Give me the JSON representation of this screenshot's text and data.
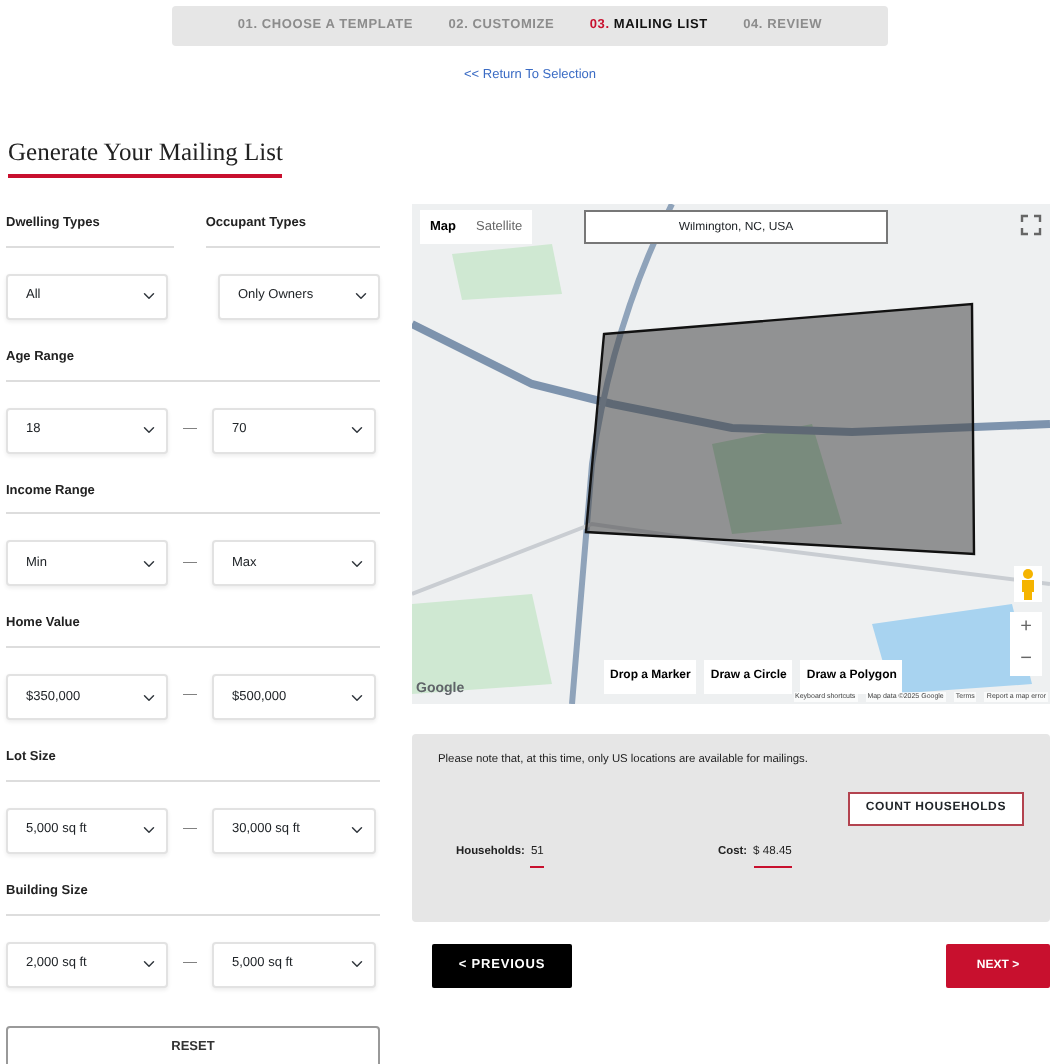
{
  "steps": [
    {
      "number": "01.",
      "label": "CHOOSE A TEMPLATE",
      "selected": false
    },
    {
      "number": "02.",
      "label": "CUSTOMIZE",
      "selected": false
    },
    {
      "number": "03.",
      "label": "MAILING LIST",
      "selected": true
    },
    {
      "number": "04.",
      "label": "REVIEW",
      "selected": false
    }
  ],
  "return_link": "<< Return To Selection",
  "heading": "Generate Your Mailing List",
  "filters": [
    {
      "kind": "pair",
      "labels": [
        "Dwelling Types",
        "Occupant Types"
      ],
      "values": [
        "All",
        "Only Owners"
      ]
    },
    {
      "kind": "range",
      "label": "Age Range",
      "from": "18",
      "separator": "—",
      "to": "70"
    },
    {
      "kind": "range",
      "label": "Income Range",
      "from": "Min",
      "separator": "—",
      "to": "Max"
    },
    {
      "kind": "range",
      "label": "Home Value",
      "from": "$350,000",
      "separator": "—",
      "to": "$500,000"
    },
    {
      "kind": "range",
      "label": "Lot Size",
      "from": "5,000 sq ft",
      "separator": "—",
      "to": "30,000 sq ft"
    },
    {
      "kind": "range",
      "label": "Building Size",
      "from": "2,000 sq ft",
      "separator": "—",
      "to": "5,000 sq ft"
    }
  ],
  "reset_button": "RESET",
  "map": {
    "tabs": [
      {
        "label": "Map",
        "selected": true
      },
      {
        "label": "Satellite",
        "selected": false
      }
    ],
    "search_value": "Wilmington, NC, USA",
    "draw_buttons": [
      "Drop a Marker",
      "Draw a Circle",
      "Draw a Polygon"
    ],
    "zoom_controls": [
      "+",
      "−"
    ],
    "logo": "Google",
    "footer_links": [
      "Keyboard shortcuts",
      "Map data ©2025 Google",
      "Terms",
      "Report a map error"
    ]
  },
  "notice": "Please note that, at this time, only US locations are available for mailings.",
  "count_button": "COUNT HOUSEHOLDS",
  "households": {
    "label": "Households:",
    "value": "51"
  },
  "cost": {
    "label": "Cost:",
    "value": "$ 48.45"
  },
  "previous_button": "< PREVIOUS",
  "next_button": "NEXT >"
}
